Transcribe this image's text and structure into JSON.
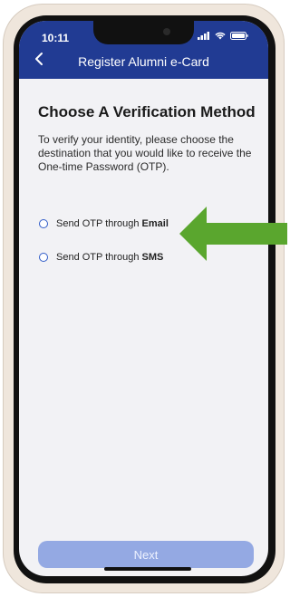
{
  "status_bar": {
    "time": "10:11"
  },
  "header": {
    "title": "Register Alumni e-Card"
  },
  "main": {
    "title": "Choose A Verification Method",
    "description": "To verify your identity, please choose the destination that you would like to receive the One-time Password (OTP).",
    "options": [
      {
        "prefix": "Send OTP through",
        "method": "Email"
      },
      {
        "prefix": "Send OTP through",
        "method": "SMS"
      }
    ]
  },
  "footer": {
    "next_label": "Next"
  },
  "colors": {
    "header": "#213b93",
    "accent": "#2f5bc8",
    "button_disabled": "#94a9e3",
    "arrow": "#5aa62e"
  },
  "icons": [
    "back-chevron-icon",
    "signal-icon",
    "wifi-icon",
    "battery-icon",
    "right-pointing-arrow"
  ]
}
